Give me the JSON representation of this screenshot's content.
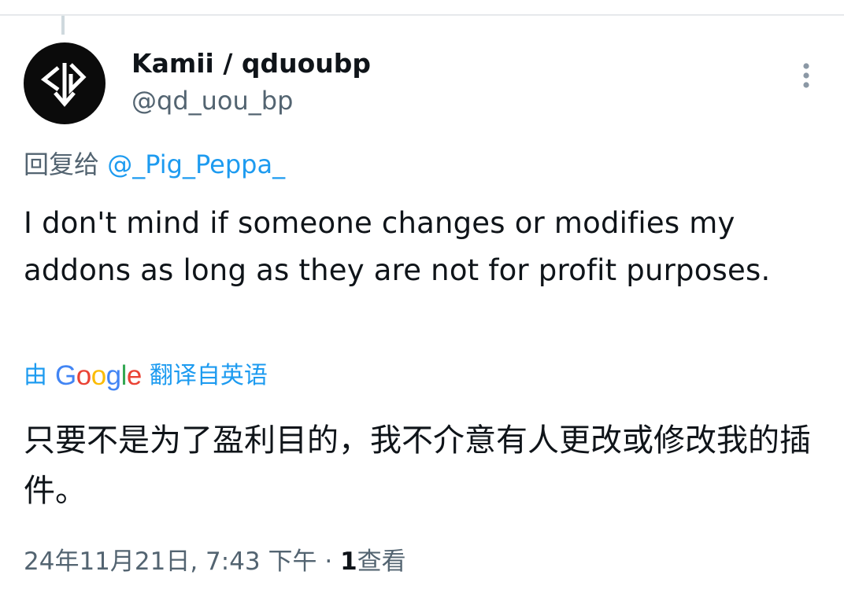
{
  "author": {
    "display_name": "Kamii / qduoubp",
    "handle": "@qd_uou_bp",
    "avatar_icon": "geometric-logo-avatar"
  },
  "menu": {
    "icon": "more-vertical-icon"
  },
  "reply": {
    "prefix": "回复给",
    "mention": "@_Pig_Peppa_"
  },
  "tweet": {
    "text": "I don't mind if someone changes or modifies my addons as long as they are not for profit purposes."
  },
  "translation": {
    "prefix": "由",
    "provider_letters": [
      "G",
      "o",
      "o",
      "g",
      "l",
      "e"
    ],
    "suffix": "翻译自英语",
    "text": "只要不是为了盈利目的，我不介意有人更改或修改我的插件。"
  },
  "meta": {
    "timestamp": "24年11月21日, 7:43 下午",
    "separator": " · ",
    "view_count": "1",
    "view_label": "查看"
  },
  "colors": {
    "link": "#1d9bf0",
    "secondary_text": "#536471",
    "primary_text": "#0f1419",
    "google_blue": "#4285f4",
    "google_red": "#ea4335",
    "google_yellow": "#fbbc05",
    "google_green": "#34a853"
  }
}
